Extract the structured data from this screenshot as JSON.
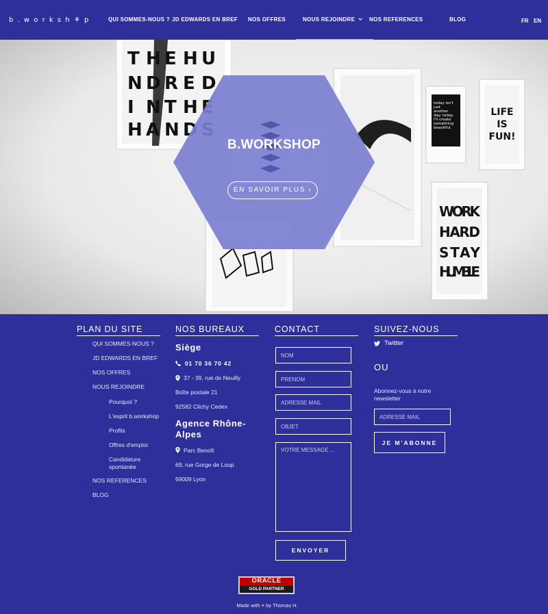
{
  "brand": {
    "logo": "b.worksh⚘p"
  },
  "nav": {
    "items": [
      {
        "label": "QUI SOMMES-NOUS ?"
      },
      {
        "label": "JD EDWARDS EN BREF"
      },
      {
        "label": "NOS OFFRES"
      },
      {
        "label": "NOUS REJOINDRE"
      },
      {
        "label": "NOS REFERENCES"
      },
      {
        "label": "BLOG"
      }
    ],
    "lang": [
      "FR",
      "EN"
    ]
  },
  "hero": {
    "title": "B.WORKSHOP",
    "cta": "EN SAVOIR PLUS ›",
    "accent_color": "#7b7fd0",
    "poster_texts": {
      "hands": [
        "T",
        "H",
        "E",
        "H",
        "U",
        "N",
        "D",
        "R",
        "E",
        "D",
        "I",
        "N",
        "T",
        "H",
        "E",
        "H",
        "A",
        "N",
        "D",
        "S"
      ],
      "life": [
        "LIFE",
        "IS",
        "FUN!"
      ],
      "work": [
        "WORK",
        "HARD",
        "STAY",
        "HUMBLE"
      ],
      "today": [
        "today isn't",
        "just",
        "another",
        "day. today",
        "I'll create",
        "something",
        "beautiful."
      ]
    }
  },
  "footer": {
    "plan": {
      "title": "PLAN DU SITE",
      "links": [
        "QUI SOMMES-NOUS ?",
        "JD EDWARDS EN BREF",
        "NOS OFFRES",
        "NOUS REJOINDRE",
        "Pourquoi ?",
        "L'esprit b.workshop",
        "Profils",
        "Offres d'emploi",
        "Candidature spontanée",
        "NOS REFERENCES",
        "BLOG"
      ]
    },
    "bureaux": {
      "title": "NOS BUREAUX",
      "siege": "Siège",
      "phone": "01 70 36 70 42",
      "siege_address": [
        "37 - 39, rue de Neuilly",
        "Boîte postale 21",
        "92582 Clichy Cedex"
      ],
      "agence": "Agence Rhône-Alpes",
      "agence_address": [
        "Parc Benoît",
        "69, rue Gorge de Loup",
        "69009 Lyon"
      ]
    },
    "contact": {
      "title": "CONTACT",
      "nom": "NOM",
      "prenom": "PRENOM",
      "email": "ADRESSE MAIL",
      "objet": "OBJET",
      "message": "VOTRE MESSAGE ...",
      "submit": "ENVOYER"
    },
    "follow": {
      "title": "SUIVEZ-NOUS",
      "twitter": "Twitter",
      "ou": "OU",
      "newsletter_text": "Abonnez-vous à notre newsletter",
      "newsletter_placeholder": "ADRESSE MAIL",
      "subscribe": "JE M'ABONNE"
    },
    "partner": {
      "brand": "ORACLE",
      "level": "GOLD PARTNER"
    },
    "credit": {
      "prefix": "Made with",
      "suffix": "by Thomas H."
    }
  }
}
